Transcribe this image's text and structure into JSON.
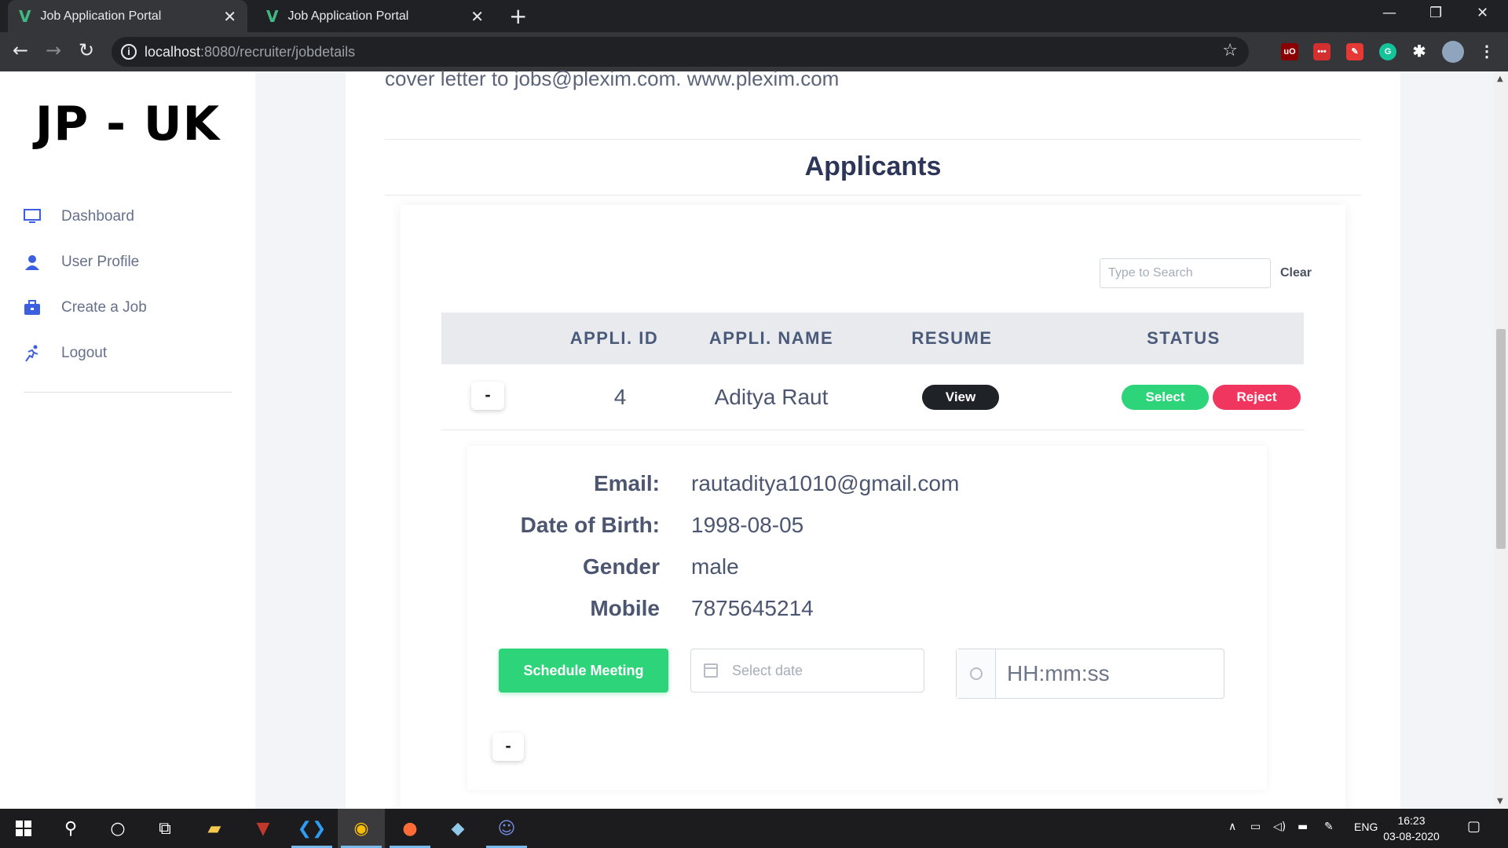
{
  "browser": {
    "tabs": [
      {
        "title": "Job Application Portal",
        "active": true
      },
      {
        "title": "Job Application Portal",
        "active": false
      }
    ],
    "url_host": "localhost",
    "url_path": ":8080/recruiter/jobdetails"
  },
  "sidebar": {
    "brand": "JP - UK",
    "items": [
      {
        "label": "Dashboard",
        "icon": "monitor-icon"
      },
      {
        "label": "User Profile",
        "icon": "user-icon"
      },
      {
        "label": "Create a Job",
        "icon": "briefcase-icon"
      },
      {
        "label": "Logout",
        "icon": "run-icon"
      }
    ]
  },
  "main": {
    "cover_text": "cover letter to jobs@plexim.com. www.plexim.com",
    "heading": "Applicants",
    "search_placeholder": "Type to Search",
    "clear_label": "Clear",
    "columns": [
      "APPLI. ID",
      "APPLI. NAME",
      "RESUME",
      "STATUS"
    ],
    "rows": [
      {
        "toggle": "-",
        "id": "4",
        "name": "Aditya Raut",
        "resume_label": "View",
        "select_label": "Select",
        "reject_label": "Reject"
      }
    ],
    "details": {
      "email_label": "Email:",
      "email": "rautaditya1010@gmail.com",
      "dob_label": "Date of Birth:",
      "dob": "1998-08-05",
      "gender_label": "Gender",
      "gender": "male",
      "mobile_label": "Mobile",
      "mobile": "7875645214",
      "schedule_label": "Schedule Meeting",
      "date_placeholder": "Select date",
      "time_placeholder": "HH:mm:ss",
      "collapse_label": "-"
    }
  },
  "taskbar": {
    "lang": "ENG",
    "time": "16:23",
    "date": "03-08-2020"
  },
  "colors": {
    "select": "#2ed47a",
    "reject": "#f0365f",
    "view": "#1f2227",
    "brand_icon": "#3b5fe0"
  }
}
